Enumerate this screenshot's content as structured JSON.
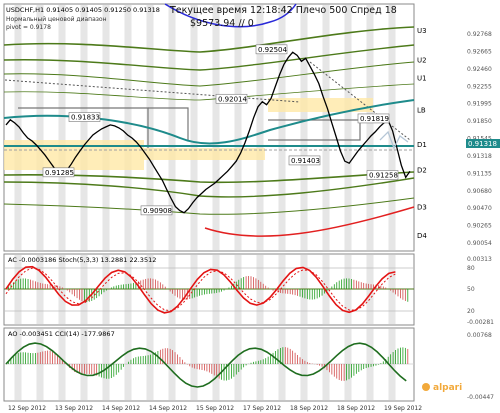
{
  "header": {
    "symbol_line": "USDCHF,H1  0.91405 0.91405 0.91250 0.91318",
    "line2": "Нормальный ценовой диапазон",
    "line3": "pivot = 0.9178",
    "time_line": "Текущее время 12:18:42 Плечо 500 Спред 18",
    "balance_line": "$9573.94    // 0"
  },
  "chart_data": [
    {
      "type": "line",
      "panel": "price",
      "title": "USDCHF,H1",
      "ylim": [
        0.9054,
        0.9276
      ],
      "right_ticks": [
        "0.92768",
        "0.92665",
        "0.92460",
        "0.92255",
        "0.91995",
        "0.91850",
        "0.91545",
        "0.91318",
        "0.91135",
        "0.90680",
        "0.90470",
        "0.90265",
        "0.90054"
      ],
      "current_price": "0.91318",
      "level_labels": [
        {
          "label": "U3",
          "value": 0.9272
        },
        {
          "label": "U2",
          "value": 0.9243
        },
        {
          "label": "U1",
          "value": 0.9225
        },
        {
          "label": "LB",
          "value": 0.9193
        },
        {
          "label": "D1",
          "value": 0.9159
        },
        {
          "label": "D2",
          "value": 0.9134
        },
        {
          "label": "D3",
          "value": 0.9097
        },
        {
          "label": "D4",
          "value": 0.9069
        }
      ],
      "price_labels": [
        {
          "text": "0.91833",
          "value": 0.91833
        },
        {
          "text": "0.91285",
          "value": 0.91285
        },
        {
          "text": "0.90908",
          "value": 0.90908
        },
        {
          "text": "0.92014",
          "value": 0.92014
        },
        {
          "text": "0.92504",
          "value": 0.92504
        },
        {
          "text": "0.91403",
          "value": 0.91403
        },
        {
          "text": "0.91819",
          "value": 0.91819
        },
        {
          "text": "0.91258",
          "value": 0.91258
        }
      ],
      "close_series": [
        0.9178,
        0.9183,
        0.918,
        0.9176,
        0.917,
        0.9165,
        0.9162,
        0.9158,
        0.9153,
        0.9148,
        0.9142,
        0.9136,
        0.9131,
        0.9129,
        0.9133,
        0.9139,
        0.9146,
        0.9152,
        0.9158,
        0.9163,
        0.9168,
        0.9171,
        0.9174,
        0.9176,
        0.9178,
        0.9177,
        0.9175,
        0.9172,
        0.9168,
        0.9165,
        0.9161,
        0.9156,
        0.915,
        0.9144,
        0.9137,
        0.913,
        0.9123,
        0.9114,
        0.9105,
        0.9097,
        0.9093,
        0.9091,
        0.9095,
        0.9101,
        0.9106,
        0.911,
        0.9114,
        0.9117,
        0.912,
        0.9124,
        0.9128,
        0.9132,
        0.9137,
        0.9142,
        0.915,
        0.916,
        0.9172,
        0.9185,
        0.9196,
        0.9201,
        0.9198,
        0.9204,
        0.9216,
        0.9228,
        0.9238,
        0.9245,
        0.925,
        0.9247,
        0.9241,
        0.9244,
        0.9236,
        0.9228,
        0.9219,
        0.9206,
        0.9194,
        0.918,
        0.9166,
        0.9152,
        0.9142,
        0.914,
        0.9146,
        0.9152,
        0.9157,
        0.9162,
        0.9167,
        0.9171,
        0.9176,
        0.918,
        0.9182,
        0.9172,
        0.9155,
        0.9138,
        0.9126,
        0.9132
      ]
    },
    {
      "type": "line",
      "panel": "ac_stoch",
      "title": "AC -0.0003186  Stoch(5,3,3) 13.2881 22.3512",
      "ylim": [
        -0.00281,
        0.00313
      ],
      "right_ticks": [
        "0.00313",
        "80",
        "50",
        "20",
        "-0.00281"
      ]
    },
    {
      "type": "line",
      "panel": "ao_cci",
      "title": "AO -0.003451  CCI(14) -177.9867",
      "ylim": [
        -0.00447,
        0.00768
      ],
      "right_ticks": [
        "0.00768",
        "-0.00447"
      ]
    }
  ],
  "time_axis": [
    "12 Sep 2012",
    "13 Sep 2012",
    "14 Sep 2012",
    "14 Sep 2012",
    "15 Sep 2012",
    "17 Sep 2012",
    "18 Sep 2012",
    "18 Sep 2012",
    "19 Sep 2012"
  ],
  "watermark": "alpari",
  "colors": {
    "background": "#ffffff",
    "price_line": "#000000",
    "teal_ma": "#1e8b8b",
    "green_bands": "#4d7a1a",
    "red_band": "#e22020",
    "blue_curve": "#2a2ad8",
    "zone_fill": "#ffe9a6",
    "stoch_red": "#e31414",
    "ac_green": "#1f9d1f"
  }
}
